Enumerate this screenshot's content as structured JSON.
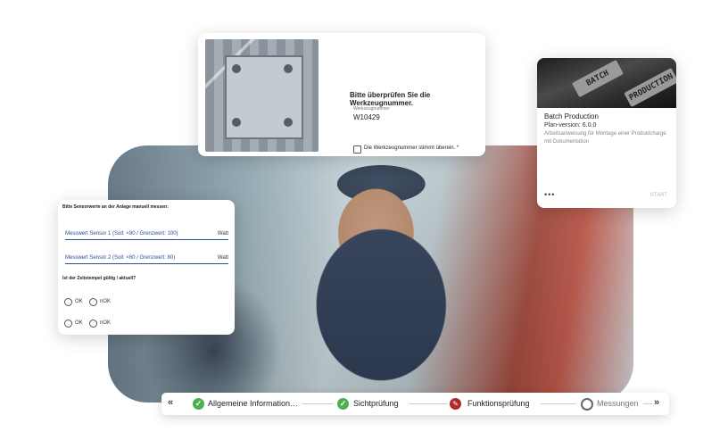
{
  "tool_card": {
    "heading": "Bitte überprüfen Sie die Werkzeugnummer.",
    "field_label": "Werkzeugnummer",
    "field_value": "W10429",
    "checkbox_label": "Die Werkzeugnummer stimmt überein. *"
  },
  "batch_card": {
    "banner_key_1": "BATCH",
    "banner_key_2": "PRODUCTION",
    "title": "Batch Production",
    "version": "Plan-version: 6.0.0",
    "description": "Arbeitsanweisung für Montage einer Produktcharge mit Dokumentation",
    "more": "•••",
    "start": "START"
  },
  "sensor_card": {
    "heading": "Bitte Sensorwerte an der Anlage manuell messen:",
    "fields": [
      {
        "label": "Messwert Sensor 1 (Soll: <80 / Grenzwert: 100)",
        "unit": "Watt"
      },
      {
        "label": "Messwert Sensor 2 (Soll: <60 / Grenzwert: 80)",
        "unit": "Watt"
      }
    ],
    "question": "Ist der Zeitstempel gültig / aktuell?",
    "options": [
      "OK",
      "nOK"
    ]
  },
  "progress": {
    "prev": "«",
    "next": "»",
    "steps": [
      {
        "label": "Allgemeine Information…",
        "status": "done",
        "icon": "check-icon"
      },
      {
        "label": "Sichtprüfung",
        "status": "done",
        "icon": "check-icon"
      },
      {
        "label": "Funktionsprüfung",
        "status": "active",
        "icon": "wrench-icon"
      },
      {
        "label": "Messungen",
        "status": "pending",
        "icon": "circle-icon"
      }
    ]
  },
  "colors": {
    "accent_blue": "#2c4f9a",
    "done_green": "#4caf50",
    "active_red": "#b0282a"
  }
}
